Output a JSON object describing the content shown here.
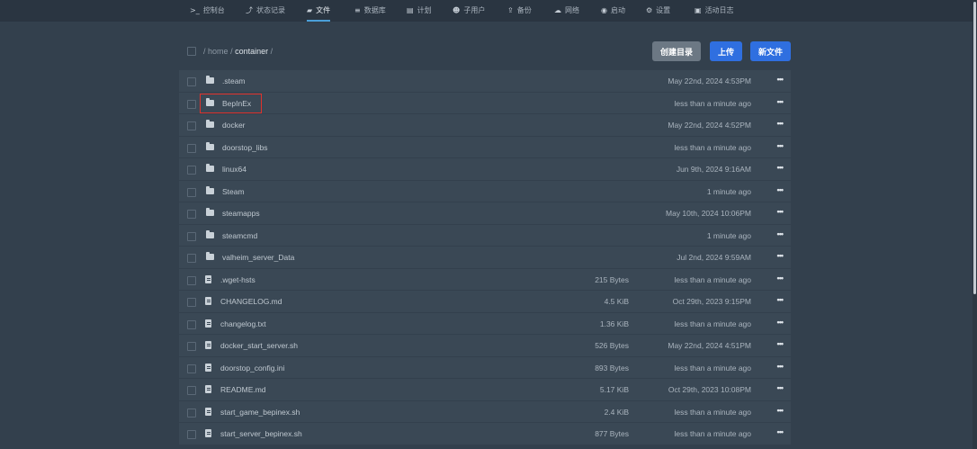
{
  "nav": {
    "items": [
      {
        "icon": ">_",
        "label": "控制台"
      },
      {
        "icon": "⤴",
        "label": "状态记录"
      },
      {
        "icon": "▰",
        "label": "文件"
      },
      {
        "icon": "≡",
        "label": "数据库"
      },
      {
        "icon": "▤",
        "label": "计划"
      },
      {
        "icon": "☻",
        "label": "子用户"
      },
      {
        "icon": "⇪",
        "label": "备份"
      },
      {
        "icon": "☁",
        "label": "网络"
      },
      {
        "icon": "◉",
        "label": "启动"
      },
      {
        "icon": "⚙",
        "label": "设置"
      },
      {
        "icon": "▣",
        "label": "活动日志"
      }
    ],
    "active_index": 2
  },
  "breadcrumb": {
    "sep": "/",
    "home": "home",
    "current": "container"
  },
  "buttons": {
    "create_dir": "创建目录",
    "upload": "上传",
    "new_file": "新文件"
  },
  "files": [
    {
      "type": "folder",
      "name": ".steam",
      "size": "",
      "date": "May 22nd, 2024 4:53PM"
    },
    {
      "type": "folder",
      "name": "BepInEx",
      "size": "",
      "date": "less than a minute ago"
    },
    {
      "type": "folder",
      "name": "docker",
      "size": "",
      "date": "May 22nd, 2024 4:52PM"
    },
    {
      "type": "folder",
      "name": "doorstop_libs",
      "size": "",
      "date": "less than a minute ago"
    },
    {
      "type": "folder",
      "name": "linux64",
      "size": "",
      "date": "Jun 9th, 2024 9:16AM"
    },
    {
      "type": "folder",
      "name": "Steam",
      "size": "",
      "date": "1 minute ago"
    },
    {
      "type": "folder",
      "name": "steamapps",
      "size": "",
      "date": "May 10th, 2024 10:06PM"
    },
    {
      "type": "folder",
      "name": "steamcmd",
      "size": "",
      "date": "1 minute ago"
    },
    {
      "type": "folder",
      "name": "valheim_server_Data",
      "size": "",
      "date": "Jul 2nd, 2024 9:59AM"
    },
    {
      "type": "file",
      "name": ".wget-hsts",
      "size": "215 Bytes",
      "date": "less than a minute ago"
    },
    {
      "type": "file",
      "name": "CHANGELOG.md",
      "size": "4.5 KiB",
      "date": "Oct 29th, 2023 9:15PM"
    },
    {
      "type": "file",
      "name": "changelog.txt",
      "size": "1.36 KiB",
      "date": "less than a minute ago"
    },
    {
      "type": "file",
      "name": "docker_start_server.sh",
      "size": "526 Bytes",
      "date": "May 22nd, 2024 4:51PM"
    },
    {
      "type": "file",
      "name": "doorstop_config.ini",
      "size": "893 Bytes",
      "date": "less than a minute ago"
    },
    {
      "type": "file",
      "name": "README.md",
      "size": "5.17 KiB",
      "date": "Oct 29th, 2023 10:08PM"
    },
    {
      "type": "file",
      "name": "start_game_bepinex.sh",
      "size": "2.4 KiB",
      "date": "less than a minute ago"
    },
    {
      "type": "file",
      "name": "start_server_bepinex.sh",
      "size": "877 Bytes",
      "date": "less than a minute ago"
    }
  ],
  "row_menu_glyph": "•••",
  "highlighted_row_index": 1,
  "colors": {
    "background": "#33404d",
    "row": "#3a4855",
    "btn_create_dir": "#6c7884",
    "btn_upload": "#2f6fe0",
    "btn_new_file": "#2f6fe0",
    "highlight": "#e0322c"
  }
}
